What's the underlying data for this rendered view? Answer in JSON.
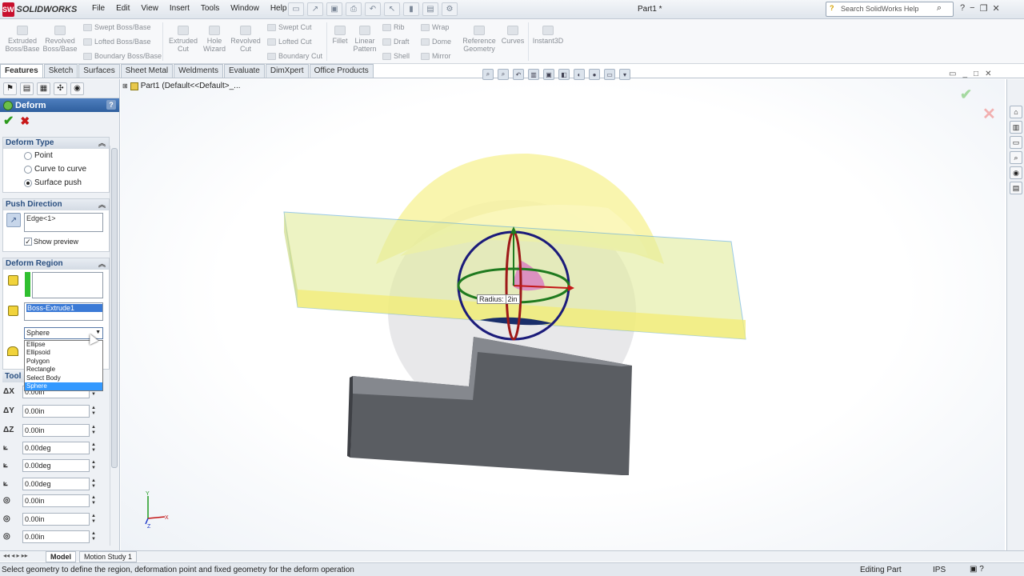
{
  "app": {
    "logo_text": "SOLIDWORKS",
    "document_title": "Part1 *"
  },
  "menu": [
    "File",
    "Edit",
    "View",
    "Insert",
    "Tools",
    "Window",
    "Help"
  ],
  "help_search": {
    "placeholder": "Search SolidWorks Help"
  },
  "command_manager": {
    "big": [
      {
        "label": "Extruded\nBoss/Base"
      },
      {
        "label": "Revolved\nBoss/Base"
      },
      {
        "label": "Extruded\nCut"
      },
      {
        "label": "Hole\nWizard"
      },
      {
        "label": "Revolved\nCut"
      },
      {
        "label": "Fillet"
      },
      {
        "label": "Linear\nPattern"
      },
      {
        "label": "Reference\nGeometry"
      },
      {
        "label": "Curves"
      },
      {
        "label": "Instant3D"
      }
    ],
    "small": [
      "Swept Boss/Base",
      "Lofted Boss/Base",
      "Boundary Boss/Base",
      "Swept Cut",
      "Lofted Cut",
      "Boundary Cut",
      "Rib",
      "Draft",
      "Shell",
      "Wrap",
      "Dome",
      "Mirror"
    ]
  },
  "tabs": [
    "Features",
    "Sketch",
    "Surfaces",
    "Sheet Metal",
    "Weldments",
    "Evaluate",
    "DimXpert",
    "Office Products"
  ],
  "property_manager": {
    "title": "Deform",
    "deform_type": {
      "header": "Deform Type",
      "options": [
        "Point",
        "Curve to curve",
        "Surface push"
      ],
      "selected": "Surface push"
    },
    "push_direction": {
      "header": "Push Direction",
      "value": "Edge<1>",
      "show_preview": "Show preview"
    },
    "deform_region": {
      "header": "Deform Region",
      "body_value": "Boss-Extrude1",
      "tool_body": "Sphere",
      "dropdown_options": [
        "Ellipse",
        "Ellipsoid",
        "Polygon",
        "Rectangle",
        "Select Body",
        "Sphere"
      ],
      "dropdown_selected": "Sphere"
    },
    "tool_header": "Tool",
    "transforms": [
      {
        "label": "ΔX",
        "value": "0.00in"
      },
      {
        "label": "ΔY",
        "value": "0.00in"
      },
      {
        "label": "ΔZ",
        "value": "0.00in"
      },
      {
        "label": "",
        "value": "0.00deg"
      },
      {
        "label": "",
        "value": "0.00deg"
      },
      {
        "label": "",
        "value": "0.00deg"
      },
      {
        "label": "",
        "value": "0.00in"
      },
      {
        "label": "",
        "value": "0.00in"
      },
      {
        "label": "",
        "value": "0.00in"
      }
    ]
  },
  "viewport": {
    "tree_fly": "Part1  (Default<<Default>_...",
    "radius_label": "Radius:",
    "radius_value": "2in"
  },
  "bottom_tabs": [
    "Model",
    "Motion Study 1"
  ],
  "status": {
    "message": "Select geometry to define the region, deformation point and fixed geometry for the deform operation",
    "mode": "Editing Part",
    "units": "IPS"
  },
  "colors": {
    "accent": "#2f5f9e",
    "ok": "#2c9a1c",
    "cancel": "#c81818",
    "sphere": "#1b1b7a"
  }
}
